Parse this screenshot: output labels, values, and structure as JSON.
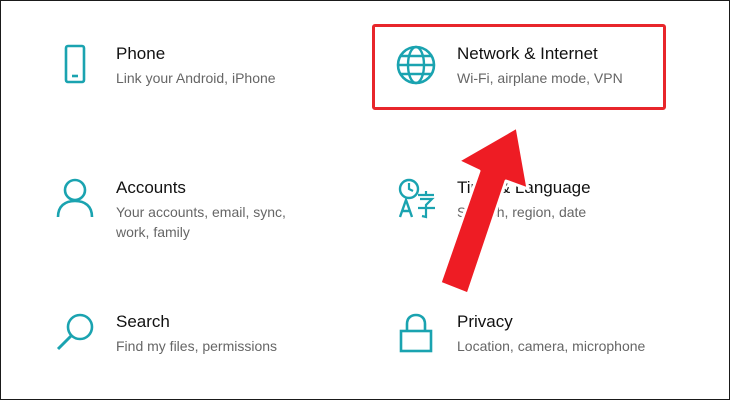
{
  "settings": {
    "tiles": [
      {
        "icon": "phone-icon",
        "title": "Phone",
        "desc": "Link your Android, iPhone"
      },
      {
        "icon": "globe-icon",
        "title": "Network & Internet",
        "desc": "Wi-Fi, airplane mode, VPN"
      },
      {
        "icon": "person-icon",
        "title": "Accounts",
        "desc": "Your accounts, email, sync, work, family"
      },
      {
        "icon": "language-icon",
        "title": "Time & Language",
        "desc": "Speech, region, date"
      },
      {
        "icon": "search-icon",
        "title": "Search",
        "desc": "Find my files, permissions"
      },
      {
        "icon": "lock-icon",
        "title": "Privacy",
        "desc": "Location, camera, microphone"
      }
    ]
  },
  "colors": {
    "icon": "#1aa3b0",
    "highlight": "#e8262b",
    "arrow": "#ee1c24"
  }
}
